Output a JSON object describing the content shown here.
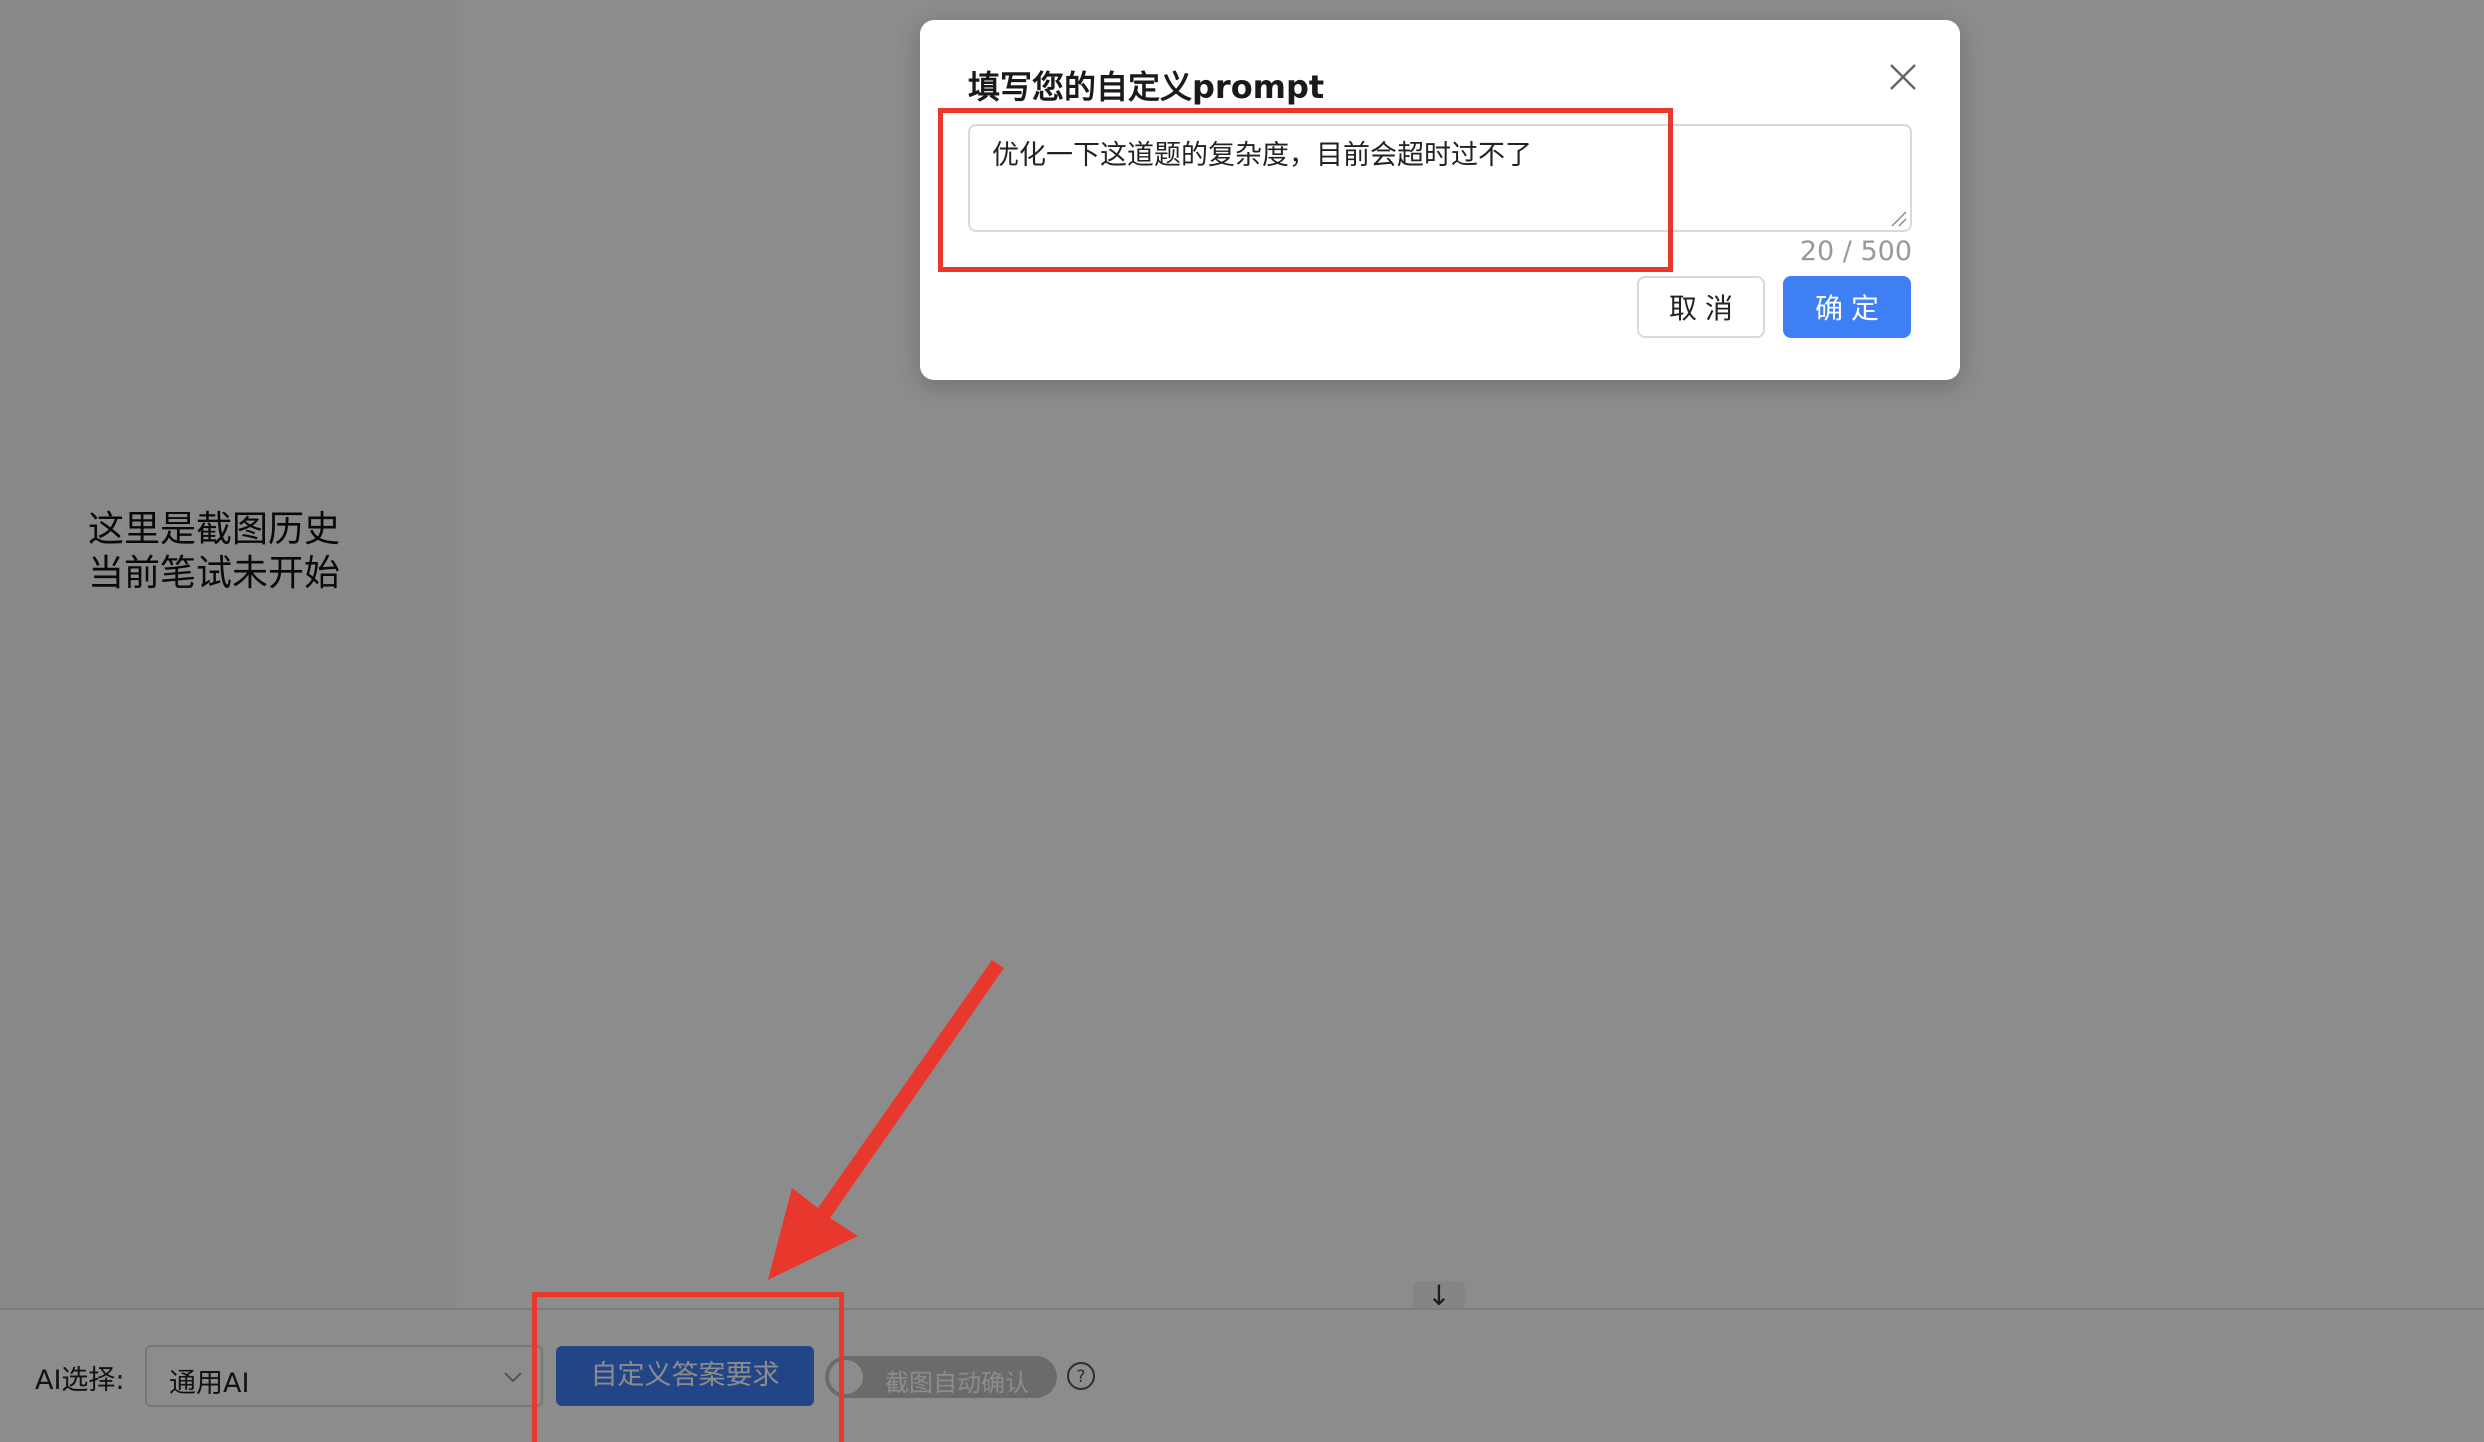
{
  "sidebar": {
    "history_line1": "这里是截图历史",
    "history_line2": "当前笔试未开始"
  },
  "bottombar": {
    "scroll_down_glyph": "↓",
    "ai_label": "AI选择:",
    "ai_select_value": "通用AI",
    "custom_button_label": "自定义答案要求",
    "auto_confirm_label": "截图自动确认",
    "auto_confirm_on": false
  },
  "modal": {
    "title": "填写您的自定义prompt",
    "textarea_value": "优化一下这道题的复杂度，目前会超时过不了",
    "char_count": "20 / 500",
    "cancel_label": "取消",
    "ok_label": "确定"
  },
  "colors": {
    "primary": "#3e7ff6",
    "annotation": "#e8382e"
  },
  "icons": {
    "close": "close-icon",
    "chevron": "chevron-down-icon",
    "help": "question-circle-icon",
    "arrow": "annotation-arrow"
  }
}
